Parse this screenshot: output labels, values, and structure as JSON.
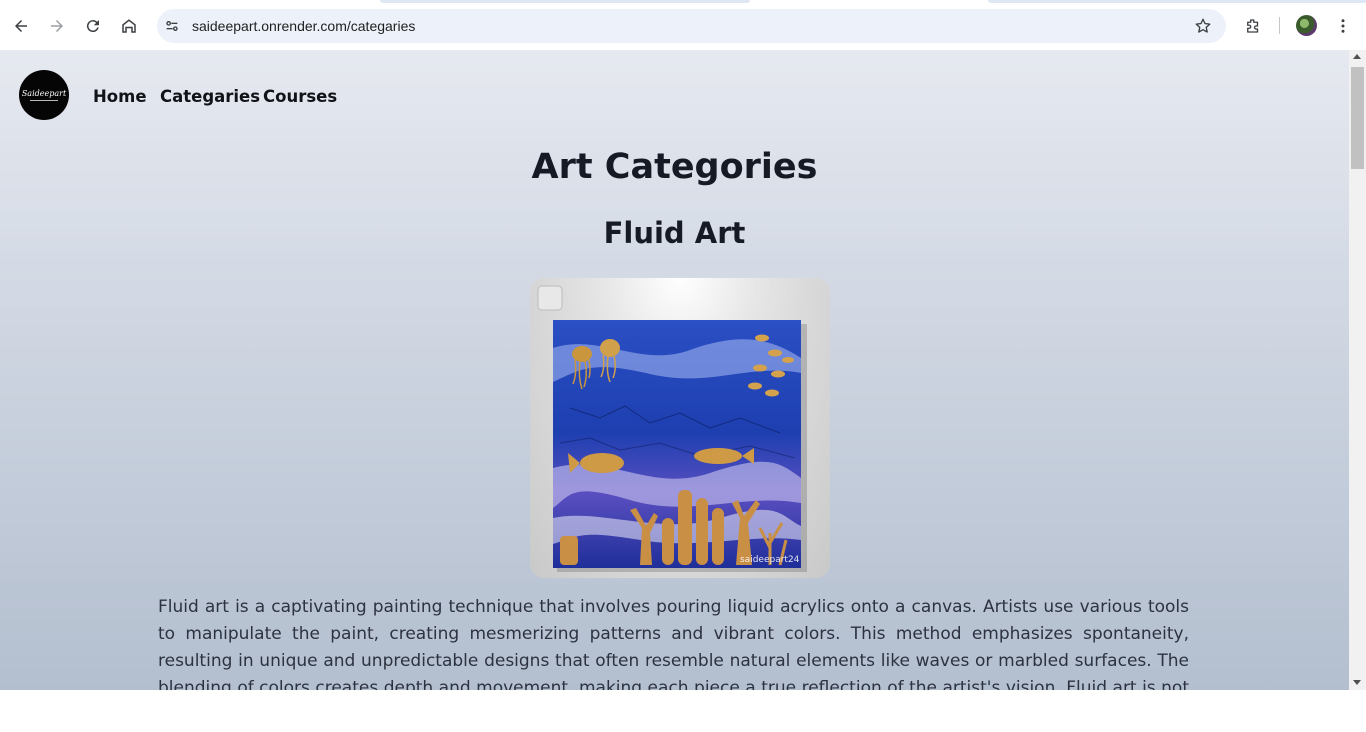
{
  "browser": {
    "url": "saideepart.onrender.com/categaries",
    "icons": [
      "back-arrow-icon",
      "forward-arrow-icon",
      "reload-icon",
      "home-icon",
      "site-info-icon",
      "bookmark-star-icon",
      "extensions-icon",
      "profile-avatar",
      "more-menu-icon"
    ]
  },
  "site": {
    "logo_text": "Saideepart",
    "nav": [
      {
        "label": "Home"
      },
      {
        "label": "Categaries"
      },
      {
        "label": "Courses"
      }
    ]
  },
  "main": {
    "page_title": "Art Categories",
    "section_title": "Fluid Art",
    "artwork_watermark": "saideepart24",
    "description": "Fluid art is a captivating painting technique that involves pouring liquid acrylics onto a canvas. Artists use various tools to manipulate the paint, creating mesmerizing patterns and vibrant colors. This method emphasizes spontaneity, resulting in unique and unpredictable designs that often resemble natural elements like waves or marbled surfaces. The blending of colors creates depth and movement, making each piece a true reflection of the artist's vision. Fluid art is not only a"
  },
  "colors": {
    "page_gradient_top": "#e6e9f0",
    "page_gradient_bottom": "#b3bfcf",
    "heading": "#161a25",
    "body_text": "#2c3240",
    "omnibox_bg": "#edf2fa"
  }
}
